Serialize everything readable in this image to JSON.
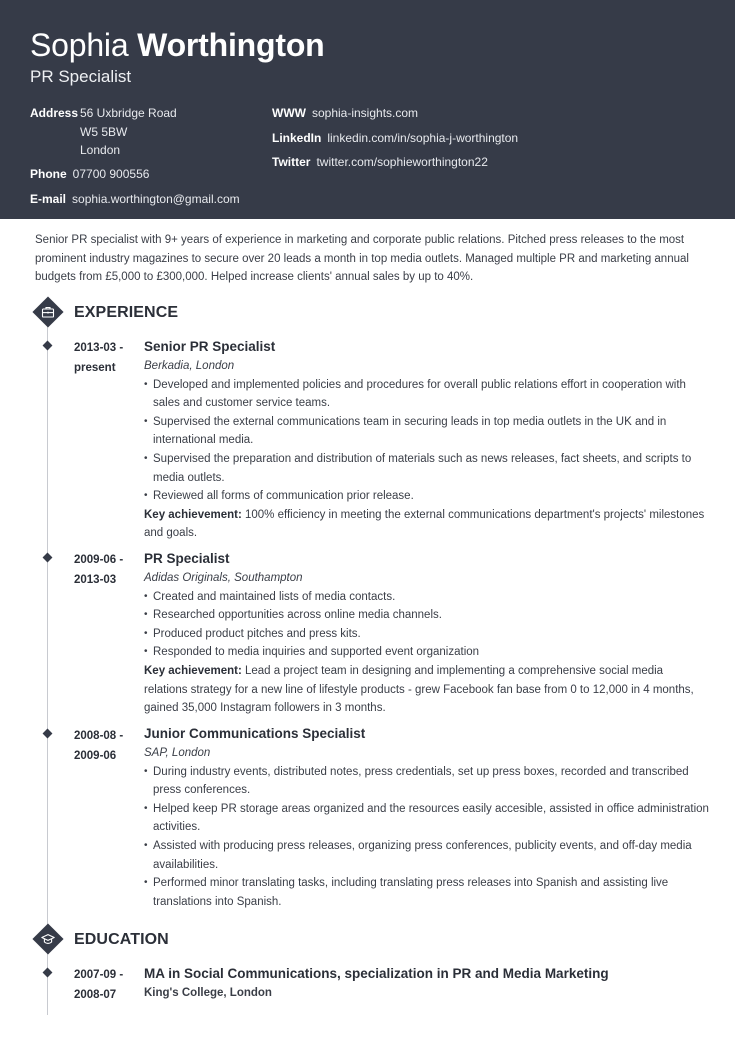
{
  "header": {
    "first_name": "Sophia",
    "last_name": "Worthington",
    "job_title": "PR Specialist",
    "contacts": {
      "address": {
        "label": "Address",
        "lines": [
          "56 Uxbridge Road",
          "W5 5BW",
          "London"
        ]
      },
      "phone": {
        "label": "Phone",
        "value": "07700 900556"
      },
      "email": {
        "label": "E-mail",
        "value": "sophia.worthington@gmail.com"
      },
      "www": {
        "label": "WWW",
        "value": "sophia-insights.com"
      },
      "linkedin": {
        "label": "LinkedIn",
        "value": "linkedin.com/in/sophia-j-worthington"
      },
      "twitter": {
        "label": "Twitter",
        "value": "twitter.com/sophieworthington22"
      }
    }
  },
  "summary": "Senior PR specialist with 9+ years of experience in marketing and corporate public relations. Pitched press releases to the most prominent industry magazines to secure over 20 leads a month in top media outlets. Managed multiple PR and marketing annual budgets from £5,000 to £300,000. Helped increase clients' annual sales by up to 40%.",
  "experience": {
    "title": "EXPERIENCE",
    "icon": "briefcase-icon",
    "entries": [
      {
        "date_start": "2013-03 -",
        "date_end": "present",
        "role": "Senior PR Specialist",
        "org": "Berkadia, London",
        "bullets": [
          "Developed and implemented policies and procedures for overall public relations effort in cooperation with sales and customer service teams.",
          "Supervised the external communications team in securing leads in top media outlets in the UK and in international media.",
          "Supervised the preparation and distribution of materials such as news releases, fact sheets, and scripts to media outlets.",
          "Reviewed all forms of communication prior release."
        ],
        "key_label": "Key achievement:",
        "key_text": " 100% efficiency in meeting the external communications department's projects' milestones and goals."
      },
      {
        "date_start": "2009-06 -",
        "date_end": "2013-03",
        "role": "PR Specialist",
        "org": "Adidas Originals, Southampton",
        "bullets": [
          "Created and maintained lists of media contacts.",
          "Researched opportunities across online media channels.",
          "Produced product pitches and press kits.",
          "Responded to media inquiries and supported event organization"
        ],
        "key_label": "Key achievement:",
        "key_text": " Lead a project team in designing and implementing a comprehensive social media relations strategy for a new line of lifestyle products - grew Facebook fan base from 0 to 12,000 in 4 months, gained 35,000 Instagram followers in 3 months."
      },
      {
        "date_start": "2008-08 -",
        "date_end": "2009-06",
        "role": "Junior Communications Specialist",
        "org": "SAP, London",
        "bullets": [
          "During industry events, distributed notes, press credentials, set up press boxes, recorded and transcribed press conferences.",
          "Helped keep PR storage areas organized and the resources easily accesible, assisted in office administration activities.",
          "Assisted with producing press releases, organizing press conferences, publicity events, and off-day media availabilities.",
          "Performed minor translating tasks, including translating press releases into Spanish and assisting live translations into Spanish."
        ]
      }
    ]
  },
  "education": {
    "title": "EDUCATION",
    "icon": "graduation-cap-icon",
    "entries": [
      {
        "date_start": "2007-09 -",
        "date_end": "2008-07",
        "degree": "MA in Social Communications, specialization in PR and Media Marketing",
        "school": "King's College, London"
      }
    ]
  },
  "colors": {
    "header_bg": "#363b48",
    "accent": "#363b48",
    "text": "#333740",
    "timeline": "#c8cad0"
  }
}
